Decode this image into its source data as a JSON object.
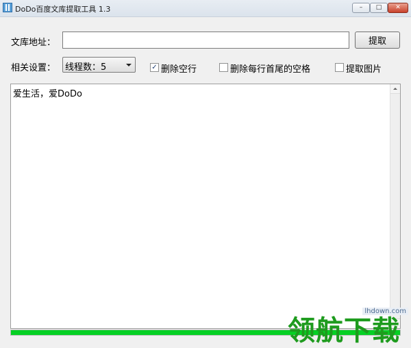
{
  "window": {
    "title": "DoDo百度文库提取工具  1.3",
    "buttons": {
      "minimize": "–",
      "maximize": "□",
      "close": "✕"
    }
  },
  "form": {
    "url_label": "文库地址：",
    "url_value": "",
    "extract_button": "提取",
    "settings_label": "相关设置：",
    "thread_select": "线程数：5",
    "options": [
      {
        "label": "删除空行",
        "checked": true
      },
      {
        "label": "删除每行首尾的空格",
        "checked": false
      },
      {
        "label": "提取图片",
        "checked": false
      }
    ]
  },
  "output": {
    "text": "爱生活，爱DoDo"
  },
  "progress": {
    "percent": 100,
    "color": "#06d024"
  },
  "watermark": {
    "site": "lhdown.com",
    "text": "领航下载"
  },
  "icons": [
    "app-icon",
    "checkbox-checked-icon",
    "dropdown-arrow-icon",
    "scroll-up-icon",
    "scroll-down-icon"
  ]
}
